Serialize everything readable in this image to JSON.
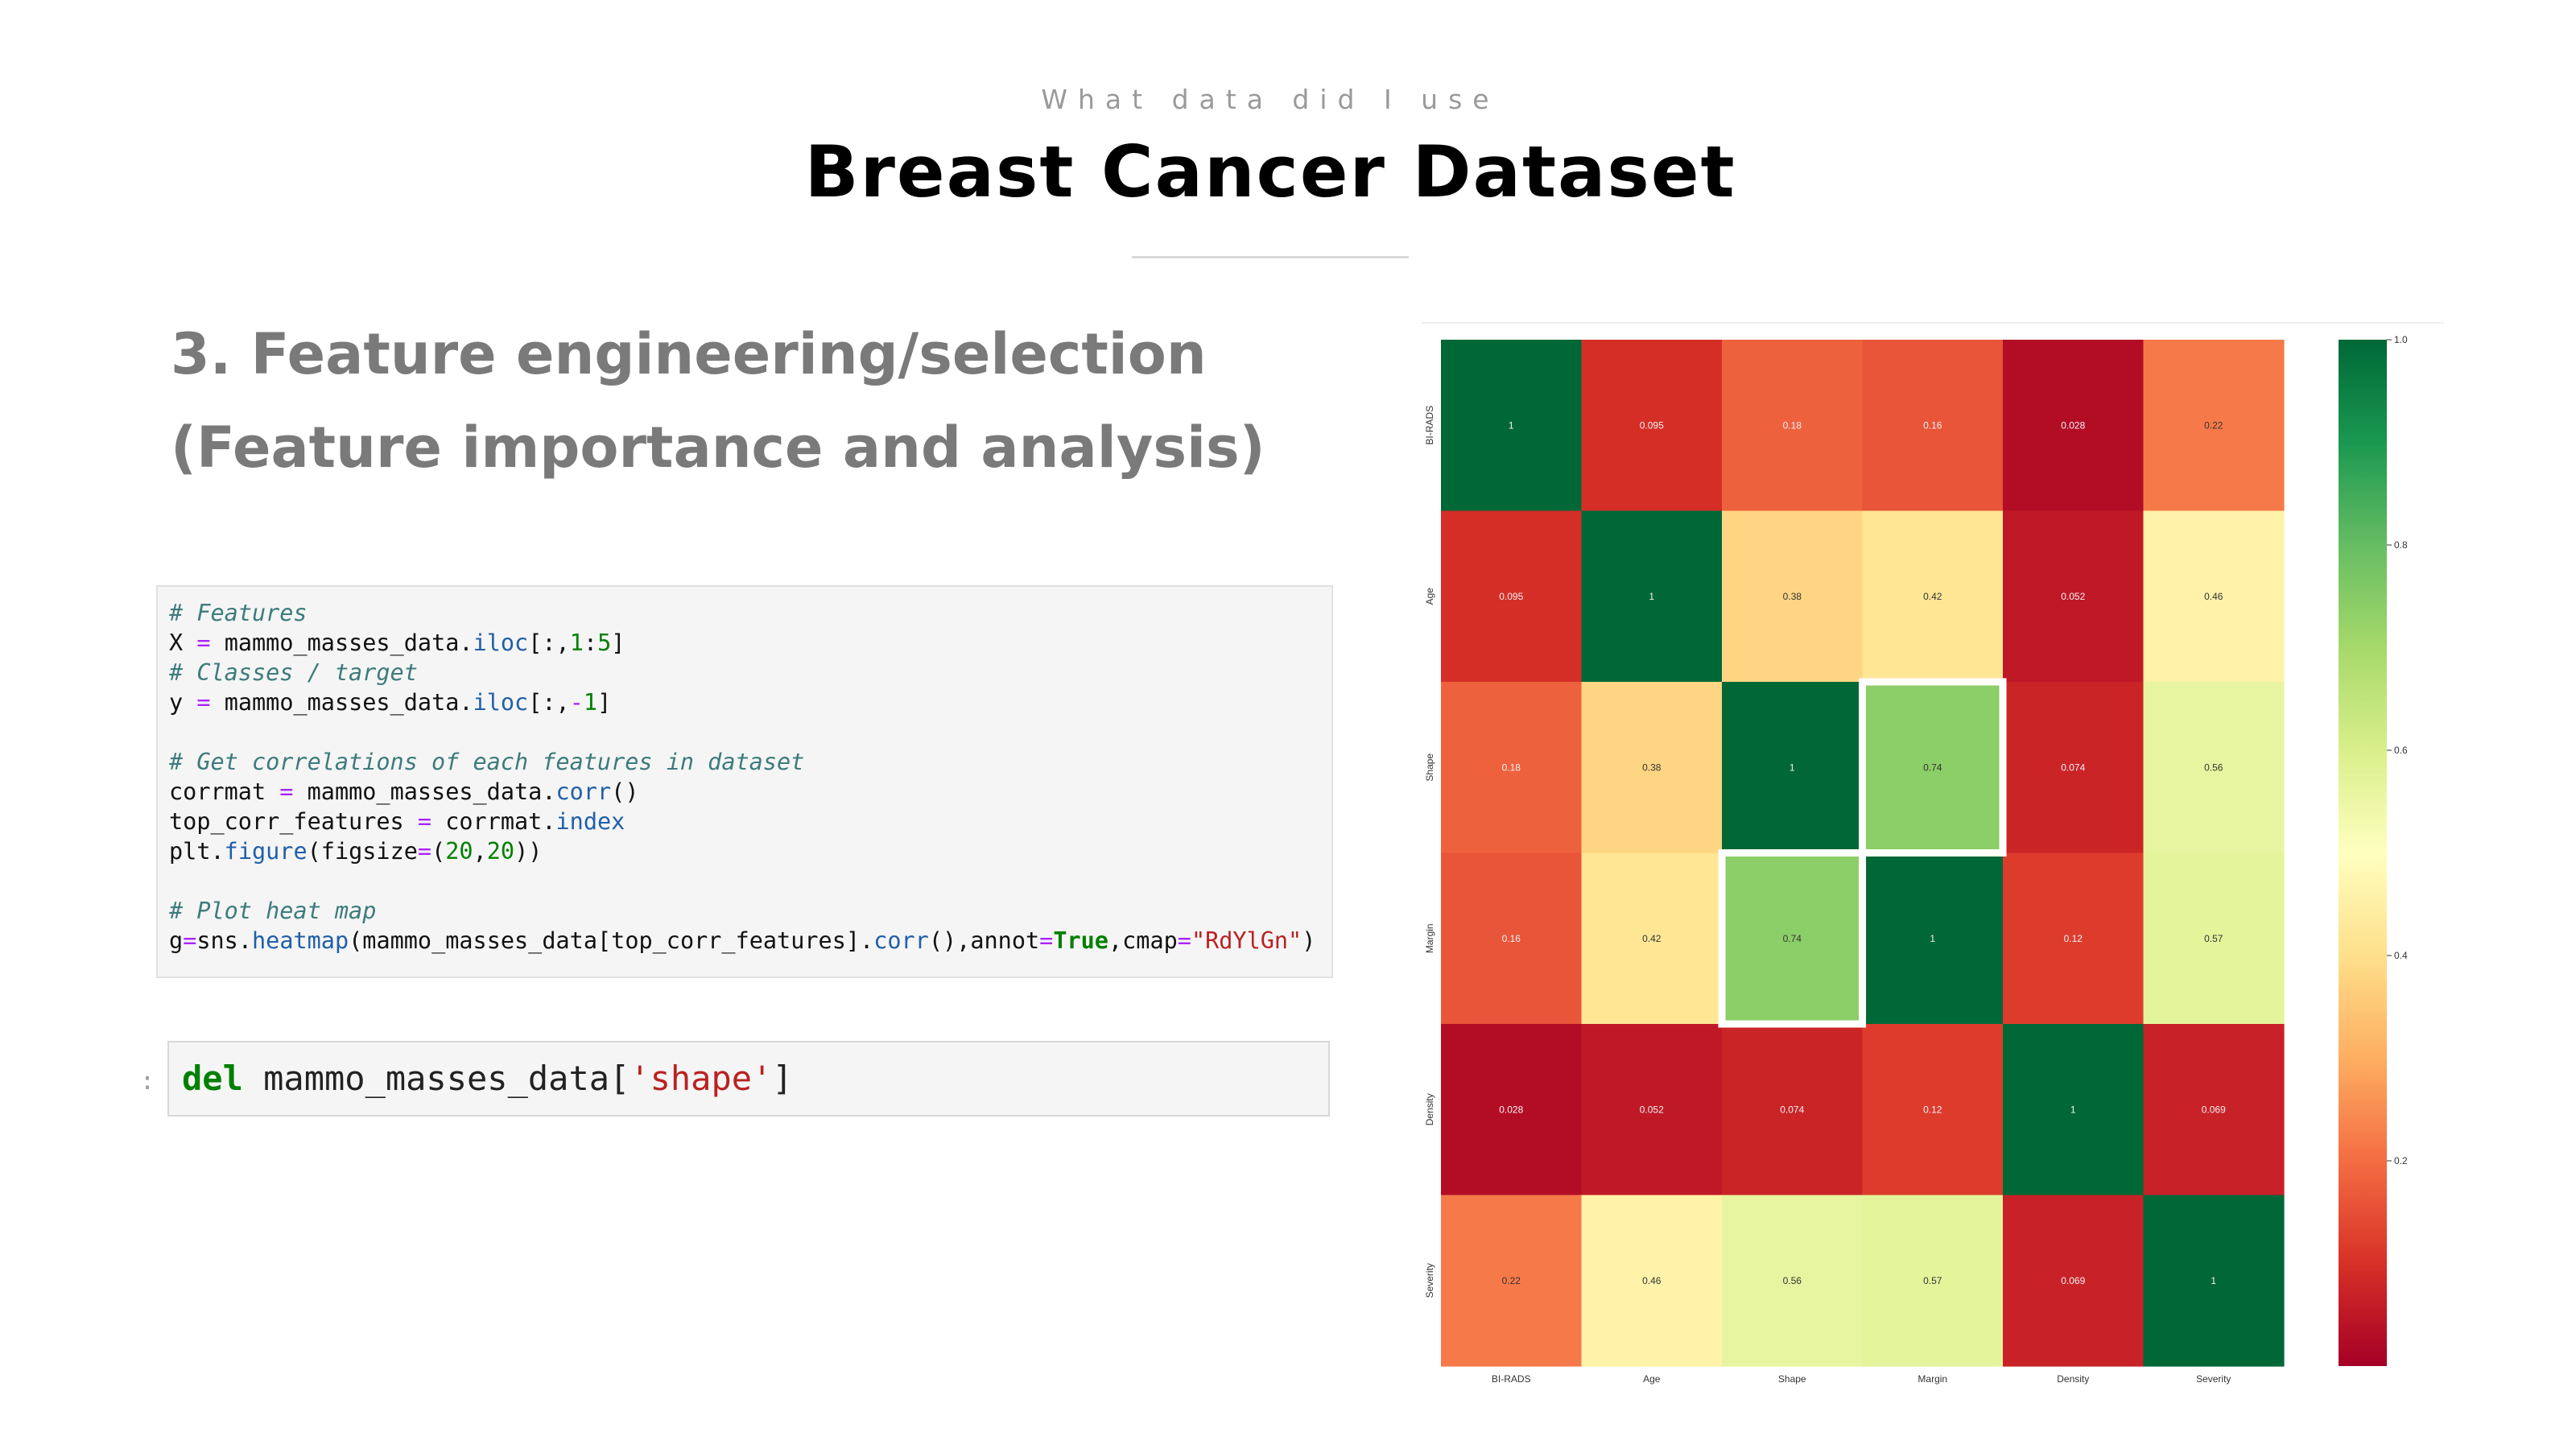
{
  "slide": {
    "eyebrow": "What data did I use",
    "title": "Breast Cancer Dataset",
    "heading_line1": "3. Feature engineering/selection",
    "heading_line2": "(Feature importance and analysis)"
  },
  "code_cell_1": {
    "lines": [
      "# Features",
      "X = mammo_masses_data.iloc[:,1:5]",
      "# Classes / target",
      "y = mammo_masses_data.iloc[:,-1]",
      "",
      "# Get correlations of each features in dataset",
      "corrmat = mammo_masses_data.corr()",
      "top_corr_features = corrmat.index",
      "plt.figure(figsize=(20,20))",
      "",
      "# Plot heat map",
      "g=sns.heatmap(mammo_masses_data[top_corr_features].corr(),annot=True,cmap=\"RdYlGn\")"
    ]
  },
  "code_cell_2": {
    "prompt": ":",
    "keyword": "del",
    "rest_prefix": " mammo_masses_data[",
    "string": "'shape'",
    "rest_suffix": "]"
  },
  "chart_data": {
    "type": "heatmap",
    "title": "",
    "colormap": "RdYlGn",
    "labels": [
      "BI-RADS",
      "Age",
      "Shape",
      "Margin",
      "Density",
      "Severity"
    ],
    "values": [
      [
        1,
        0.095,
        0.18,
        0.16,
        0.028,
        0.22
      ],
      [
        0.095,
        1,
        0.38,
        0.42,
        0.052,
        0.46
      ],
      [
        0.18,
        0.38,
        1,
        0.74,
        0.074,
        0.56
      ],
      [
        0.16,
        0.42,
        0.74,
        1,
        0.12,
        0.57
      ],
      [
        0.028,
        0.052,
        0.074,
        0.12,
        1,
        0.069
      ],
      [
        0.22,
        0.46,
        0.56,
        0.57,
        0.069,
        1
      ]
    ],
    "highlighted_cells": [
      [
        2,
        3
      ],
      [
        3,
        2
      ]
    ],
    "highlight_color": "#ffffff",
    "colorbar": {
      "range": [
        0.0,
        1.0
      ],
      "ticks": [
        "0.2",
        "0.4",
        "0.6",
        "0.8",
        "1.0"
      ],
      "tick_values": [
        0.2,
        0.4,
        0.6,
        0.8,
        1.0
      ]
    }
  }
}
